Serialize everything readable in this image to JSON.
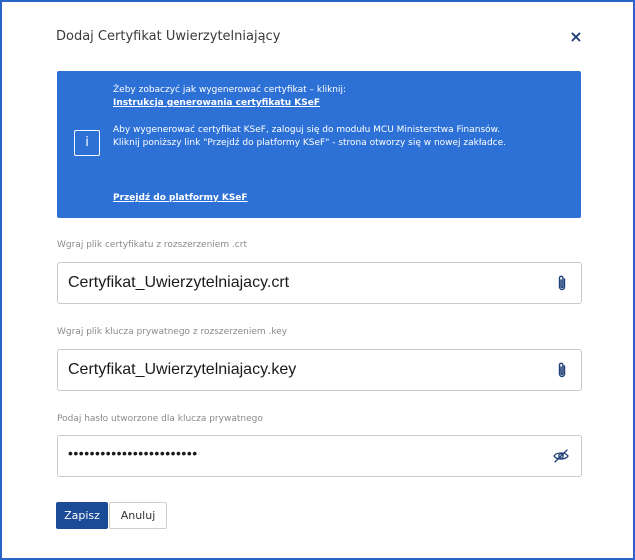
{
  "dialog": {
    "title": "Dodaj Certyfikat Uwierzytelniający",
    "close_label": "×"
  },
  "info": {
    "icon_label": "i",
    "line1": "Żeby zobaczyć jak wygenerować certyfikat – kliknij:",
    "link1": "Instrukcja generowania certyfikatu KSeF",
    "line2": "Aby wygenerować certyfikat KSeF, zaloguj się do modułu MCU Ministerstwa Finansów.",
    "line3": "Kliknij poniższy link \"Przejdź do platformy KSeF\" - strona otworzy się w nowej zakładce.",
    "link2": "Przejdź do platformy KSeF"
  },
  "fields": {
    "crt": {
      "label": "Wgraj plik certyfikatu z rozszerzeniem .crt",
      "value": "Certyfikat_Uwierzytelniajacy.crt",
      "icon": "paperclip-icon"
    },
    "key": {
      "label": "Wgraj plik klucza prywatnego z rozszerzeniem .key",
      "value": "Certyfikat_Uwierzytelniajacy.key",
      "icon": "paperclip-icon"
    },
    "password": {
      "label": "Podaj hasło utworzone dla klucza prywatnego",
      "value": "••••••••••••••••••••••••",
      "icon": "eye-off-icon"
    }
  },
  "buttons": {
    "save": "Zapisz",
    "cancel": "Anuluj"
  },
  "colors": {
    "accent": "#2d71d6",
    "primary_button": "#1b4a96",
    "frame_border": "#2a62c6"
  }
}
